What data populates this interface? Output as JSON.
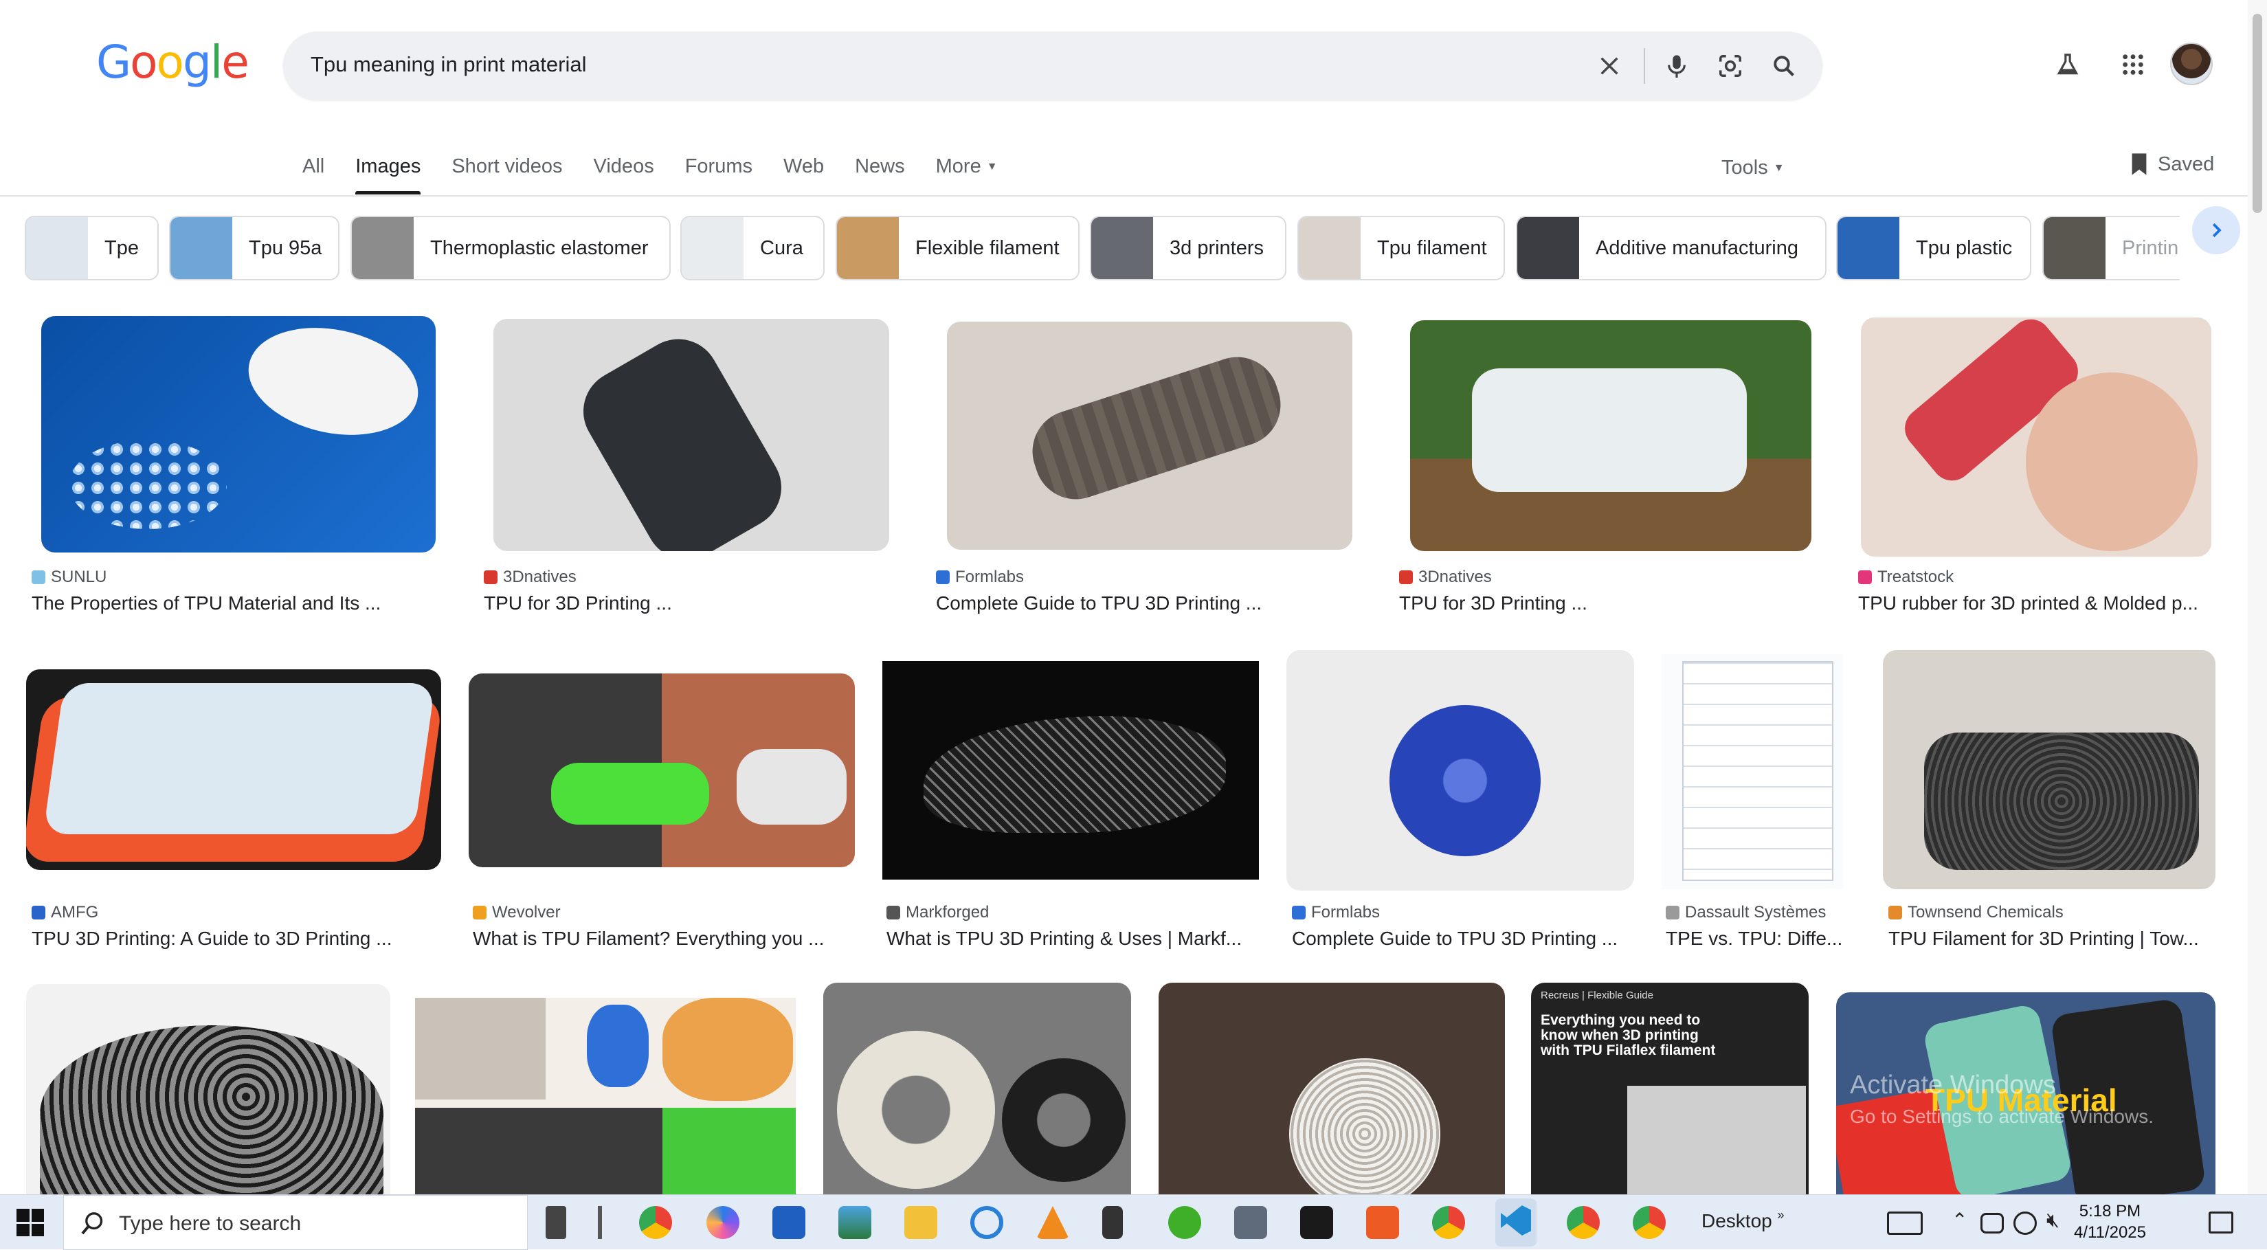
{
  "logo": {
    "letters": [
      "G",
      "o",
      "o",
      "g",
      "l",
      "e"
    ],
    "colors": [
      "#4285F4",
      "#EA4335",
      "#FBBC05",
      "#4285F4",
      "#34A853",
      "#EA4335"
    ]
  },
  "search": {
    "query": "Tpu meaning in print material"
  },
  "tabs": [
    {
      "label": "All",
      "active": false
    },
    {
      "label": "Images",
      "active": true
    },
    {
      "label": "Short videos",
      "active": false
    },
    {
      "label": "Videos",
      "active": false
    },
    {
      "label": "Forums",
      "active": false
    },
    {
      "label": "Web",
      "active": false
    },
    {
      "label": "News",
      "active": false
    },
    {
      "label": "More",
      "active": false
    }
  ],
  "tools_label": "Tools",
  "saved_label": "Saved",
  "chips": [
    {
      "label": "Tpe",
      "thumb": "#dfe6ee"
    },
    {
      "label": "Tpu 95a",
      "thumb": "#6fa6d8"
    },
    {
      "label": "Thermoplastic elastomer",
      "thumb": "#8c8c8c"
    },
    {
      "label": "Cura",
      "thumb": "#e9ecef"
    },
    {
      "label": "Flexible filament",
      "thumb": "#c99b63"
    },
    {
      "label": "3d printers",
      "thumb": "#666a70"
    },
    {
      "label": "Tpu filament",
      "thumb": "#d9d3cb"
    },
    {
      "label": "Additive manufacturing",
      "thumb": "#3b3d42"
    },
    {
      "label": "Tpu plastic",
      "thumb": "#2a66b8"
    },
    {
      "label": "Printin",
      "thumb": "#5a5650"
    }
  ],
  "results_row1": [
    {
      "source": "SUNLU",
      "title": "The Properties of TPU Material and Its ...",
      "color": "#0d5bb5",
      "fav": "#7ec0e6"
    },
    {
      "source": "3Dnatives",
      "title": "TPU for 3D Printing ...",
      "color": "#d8d8d8",
      "fav": "#d9382c"
    },
    {
      "source": "Formlabs",
      "title": "Complete Guide to TPU 3D Printing ...",
      "color": "#b9b4ae",
      "fav": "#2d6fd6"
    },
    {
      "source": "3Dnatives",
      "title": "TPU for 3D Printing ...",
      "color": "#3f6b2e",
      "fav": "#d9382c"
    },
    {
      "source": "Treatstock",
      "title": "TPU rubber for 3D printed & Molded p...",
      "color": "#e2c3b2",
      "fav": "#e4347a"
    }
  ],
  "results_row2": [
    {
      "source": "AMFG",
      "title": "TPU 3D Printing: A Guide to 3D Printing ...",
      "color": "#1b1b1b",
      "fav": "#2a63c9"
    },
    {
      "source": "Wevolver",
      "title": "What is TPU Filament? Everything you ...",
      "color": "#8a6a4f",
      "fav": "#f0a020"
    },
    {
      "source": "Markforged",
      "title": "What is TPU 3D Printing & Uses | Markf...",
      "color": "#0a0a0a",
      "fav": "#555555"
    },
    {
      "source": "Formlabs",
      "title": "Complete Guide to TPU 3D Printing ...",
      "color": "#e6e6e6",
      "fav": "#2d6fd6"
    },
    {
      "source": "Dassault Systèmes",
      "title": "TPE vs. TPU: Diffe...",
      "color": "#f2f4f7",
      "fav": "#9a9a9a"
    },
    {
      "source": "Townsend Chemicals",
      "title": "TPU Filament for 3D Printing | Tow...",
      "color": "#cfcbc6",
      "fav": "#e58a2a"
    }
  ],
  "results_row3": [
    {
      "color": "#d8d8d8"
    },
    {
      "color": "#f3efe8"
    },
    {
      "color": "#6f6f6f"
    },
    {
      "color": "#4a3a34"
    },
    {
      "color": "#222222",
      "caption_top": "Recreus | Flexible Guide",
      "caption_main": "Everything you need to know when 3D printing with TPU Filaflex filament"
    },
    {
      "color": "#3d5a86",
      "overlay": "TPU Material"
    }
  ],
  "watermark": {
    "line1": "Activate Windows",
    "line2": "Go to Settings to activate Windows."
  },
  "taskbar": {
    "search_placeholder": "Type here to search",
    "desktop_label": "Desktop",
    "time": "5:18 PM",
    "date": "4/11/2025"
  }
}
